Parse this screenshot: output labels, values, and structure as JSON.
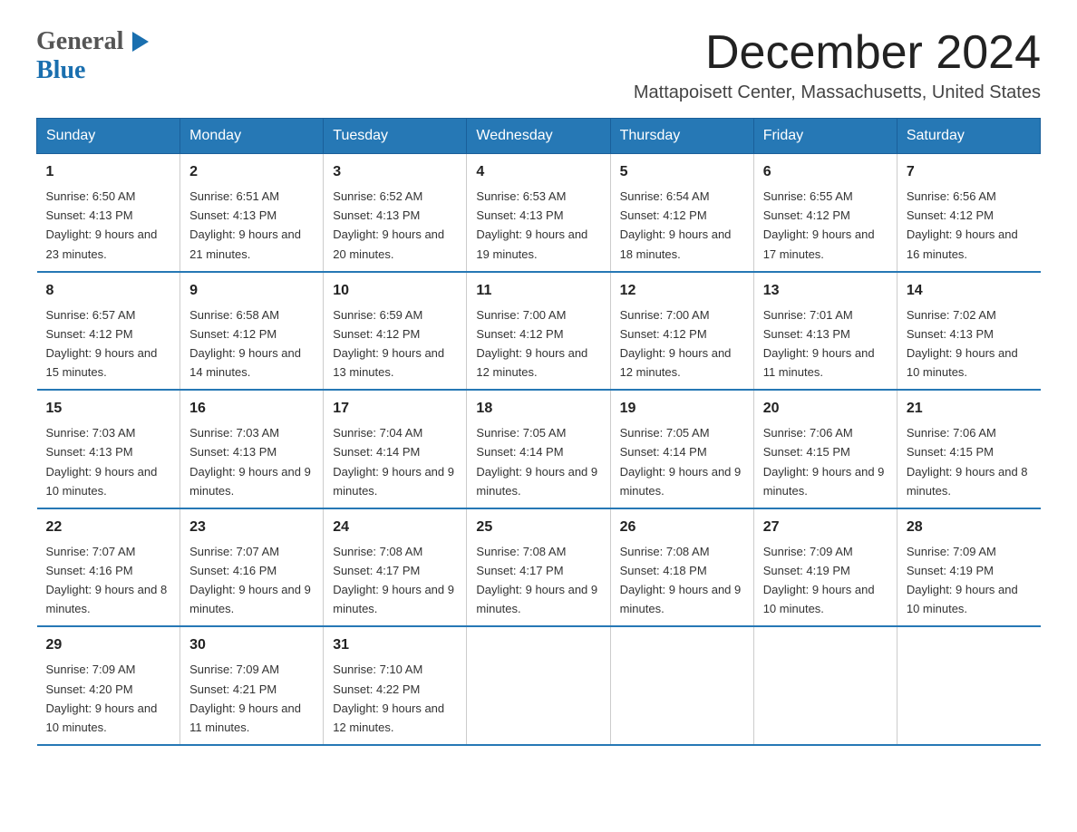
{
  "header": {
    "logo_line1": "General",
    "logo_arrow": "▶",
    "logo_line2": "Blue",
    "month_title": "December 2024",
    "location": "Mattapoisett Center, Massachusetts, United States"
  },
  "days_of_week": [
    "Sunday",
    "Monday",
    "Tuesday",
    "Wednesday",
    "Thursday",
    "Friday",
    "Saturday"
  ],
  "weeks": [
    [
      {
        "day": "1",
        "sunrise": "Sunrise: 6:50 AM",
        "sunset": "Sunset: 4:13 PM",
        "daylight": "Daylight: 9 hours and 23 minutes."
      },
      {
        "day": "2",
        "sunrise": "Sunrise: 6:51 AM",
        "sunset": "Sunset: 4:13 PM",
        "daylight": "Daylight: 9 hours and 21 minutes."
      },
      {
        "day": "3",
        "sunrise": "Sunrise: 6:52 AM",
        "sunset": "Sunset: 4:13 PM",
        "daylight": "Daylight: 9 hours and 20 minutes."
      },
      {
        "day": "4",
        "sunrise": "Sunrise: 6:53 AM",
        "sunset": "Sunset: 4:13 PM",
        "daylight": "Daylight: 9 hours and 19 minutes."
      },
      {
        "day": "5",
        "sunrise": "Sunrise: 6:54 AM",
        "sunset": "Sunset: 4:12 PM",
        "daylight": "Daylight: 9 hours and 18 minutes."
      },
      {
        "day": "6",
        "sunrise": "Sunrise: 6:55 AM",
        "sunset": "Sunset: 4:12 PM",
        "daylight": "Daylight: 9 hours and 17 minutes."
      },
      {
        "day": "7",
        "sunrise": "Sunrise: 6:56 AM",
        "sunset": "Sunset: 4:12 PM",
        "daylight": "Daylight: 9 hours and 16 minutes."
      }
    ],
    [
      {
        "day": "8",
        "sunrise": "Sunrise: 6:57 AM",
        "sunset": "Sunset: 4:12 PM",
        "daylight": "Daylight: 9 hours and 15 minutes."
      },
      {
        "day": "9",
        "sunrise": "Sunrise: 6:58 AM",
        "sunset": "Sunset: 4:12 PM",
        "daylight": "Daylight: 9 hours and 14 minutes."
      },
      {
        "day": "10",
        "sunrise": "Sunrise: 6:59 AM",
        "sunset": "Sunset: 4:12 PM",
        "daylight": "Daylight: 9 hours and 13 minutes."
      },
      {
        "day": "11",
        "sunrise": "Sunrise: 7:00 AM",
        "sunset": "Sunset: 4:12 PM",
        "daylight": "Daylight: 9 hours and 12 minutes."
      },
      {
        "day": "12",
        "sunrise": "Sunrise: 7:00 AM",
        "sunset": "Sunset: 4:12 PM",
        "daylight": "Daylight: 9 hours and 12 minutes."
      },
      {
        "day": "13",
        "sunrise": "Sunrise: 7:01 AM",
        "sunset": "Sunset: 4:13 PM",
        "daylight": "Daylight: 9 hours and 11 minutes."
      },
      {
        "day": "14",
        "sunrise": "Sunrise: 7:02 AM",
        "sunset": "Sunset: 4:13 PM",
        "daylight": "Daylight: 9 hours and 10 minutes."
      }
    ],
    [
      {
        "day": "15",
        "sunrise": "Sunrise: 7:03 AM",
        "sunset": "Sunset: 4:13 PM",
        "daylight": "Daylight: 9 hours and 10 minutes."
      },
      {
        "day": "16",
        "sunrise": "Sunrise: 7:03 AM",
        "sunset": "Sunset: 4:13 PM",
        "daylight": "Daylight: 9 hours and 9 minutes."
      },
      {
        "day": "17",
        "sunrise": "Sunrise: 7:04 AM",
        "sunset": "Sunset: 4:14 PM",
        "daylight": "Daylight: 9 hours and 9 minutes."
      },
      {
        "day": "18",
        "sunrise": "Sunrise: 7:05 AM",
        "sunset": "Sunset: 4:14 PM",
        "daylight": "Daylight: 9 hours and 9 minutes."
      },
      {
        "day": "19",
        "sunrise": "Sunrise: 7:05 AM",
        "sunset": "Sunset: 4:14 PM",
        "daylight": "Daylight: 9 hours and 9 minutes."
      },
      {
        "day": "20",
        "sunrise": "Sunrise: 7:06 AM",
        "sunset": "Sunset: 4:15 PM",
        "daylight": "Daylight: 9 hours and 9 minutes."
      },
      {
        "day": "21",
        "sunrise": "Sunrise: 7:06 AM",
        "sunset": "Sunset: 4:15 PM",
        "daylight": "Daylight: 9 hours and 8 minutes."
      }
    ],
    [
      {
        "day": "22",
        "sunrise": "Sunrise: 7:07 AM",
        "sunset": "Sunset: 4:16 PM",
        "daylight": "Daylight: 9 hours and 8 minutes."
      },
      {
        "day": "23",
        "sunrise": "Sunrise: 7:07 AM",
        "sunset": "Sunset: 4:16 PM",
        "daylight": "Daylight: 9 hours and 9 minutes."
      },
      {
        "day": "24",
        "sunrise": "Sunrise: 7:08 AM",
        "sunset": "Sunset: 4:17 PM",
        "daylight": "Daylight: 9 hours and 9 minutes."
      },
      {
        "day": "25",
        "sunrise": "Sunrise: 7:08 AM",
        "sunset": "Sunset: 4:17 PM",
        "daylight": "Daylight: 9 hours and 9 minutes."
      },
      {
        "day": "26",
        "sunrise": "Sunrise: 7:08 AM",
        "sunset": "Sunset: 4:18 PM",
        "daylight": "Daylight: 9 hours and 9 minutes."
      },
      {
        "day": "27",
        "sunrise": "Sunrise: 7:09 AM",
        "sunset": "Sunset: 4:19 PM",
        "daylight": "Daylight: 9 hours and 10 minutes."
      },
      {
        "day": "28",
        "sunrise": "Sunrise: 7:09 AM",
        "sunset": "Sunset: 4:19 PM",
        "daylight": "Daylight: 9 hours and 10 minutes."
      }
    ],
    [
      {
        "day": "29",
        "sunrise": "Sunrise: 7:09 AM",
        "sunset": "Sunset: 4:20 PM",
        "daylight": "Daylight: 9 hours and 10 minutes."
      },
      {
        "day": "30",
        "sunrise": "Sunrise: 7:09 AM",
        "sunset": "Sunset: 4:21 PM",
        "daylight": "Daylight: 9 hours and 11 minutes."
      },
      {
        "day": "31",
        "sunrise": "Sunrise: 7:10 AM",
        "sunset": "Sunset: 4:22 PM",
        "daylight": "Daylight: 9 hours and 12 minutes."
      },
      null,
      null,
      null,
      null
    ]
  ]
}
